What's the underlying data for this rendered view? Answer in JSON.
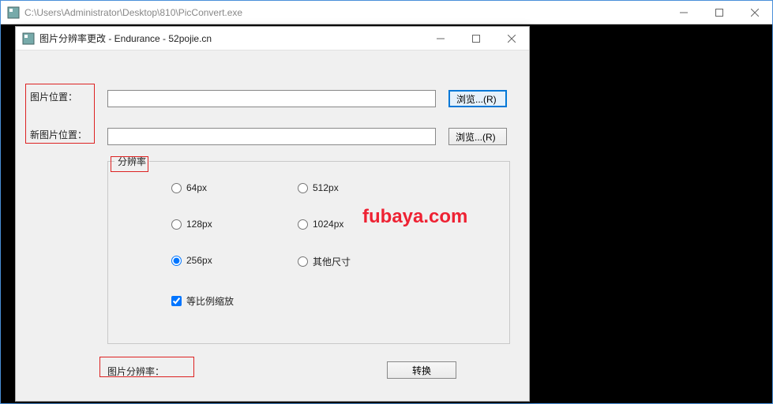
{
  "outer": {
    "title": "C:\\Users\\Administrator\\Desktop\\810\\PicConvert.exe",
    "controls": {
      "minimize": "—",
      "maximize": "☐",
      "close": "✕"
    }
  },
  "dialog": {
    "title": "图片分辨率更改 - Endurance - 52pojie.cn",
    "controls": {
      "minimize": "—",
      "maximize": "☐",
      "close": "✕"
    },
    "image_path_label": "图片位置：",
    "image_path_value": "",
    "browse1_label": "浏览...(R)",
    "new_image_path_label": "新图片位置：",
    "new_image_path_value": "",
    "browse2_label": "浏览...(R)",
    "group_legend": "分辨率",
    "radios": {
      "r64": "64px",
      "r128": "128px",
      "r256": "256px",
      "r512": "512px",
      "r1024": "1024px",
      "rOther": "其他尺寸"
    },
    "scale_checkbox_label": "等比例缩放",
    "bottom_label": "图片分辨率：",
    "convert_label": "转换"
  },
  "watermark": "fubaya.com"
}
